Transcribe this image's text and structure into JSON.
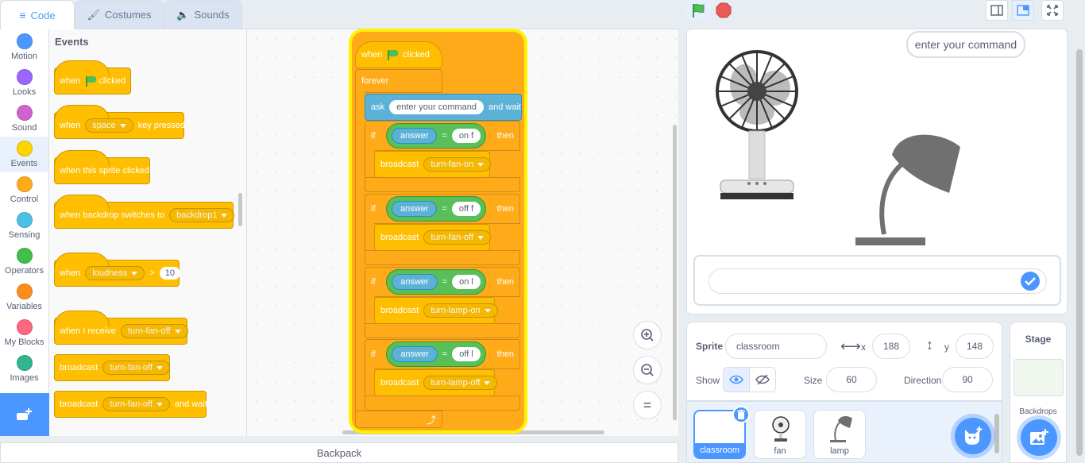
{
  "tabs": {
    "code": "Code",
    "costumes": "Costumes",
    "sounds": "Sounds"
  },
  "categories": [
    {
      "label": "Motion",
      "color": "#4c97ff"
    },
    {
      "label": "Looks",
      "color": "#9966ff"
    },
    {
      "label": "Sound",
      "color": "#cf63cf"
    },
    {
      "label": "Events",
      "color": "#ffd500"
    },
    {
      "label": "Control",
      "color": "#ffab19"
    },
    {
      "label": "Sensing",
      "color": "#4cbfe6"
    },
    {
      "label": "Operators",
      "color": "#40bf4a"
    },
    {
      "label": "Variables",
      "color": "#ff8c1a"
    },
    {
      "label": "My Blocks",
      "color": "#ff6680"
    },
    {
      "label": "Images",
      "color": "#2fb58f"
    }
  ],
  "palette": {
    "title": "Events",
    "when": "when",
    "clicked": "clicked",
    "key": "space",
    "key_pressed": "key pressed",
    "sprite_clicked": "when this sprite clicked",
    "backdrop_switches": "when backdrop switches to",
    "backdrop": "backdrop1",
    "loudness": "loudness",
    "gt": ">",
    "loudness_value": "10",
    "when_receive": "when I receive",
    "receive_msg": "turn-fan-off",
    "broadcast": "broadcast",
    "broadcast_msg": "turn-fan-off",
    "and_wait": "and wait"
  },
  "script": {
    "when": "when",
    "clicked": "clicked",
    "forever": "forever",
    "ask": "ask",
    "ask_text": "enter your command",
    "and_wait": "and wait",
    "if": "if",
    "then": "then",
    "answer": "answer",
    "eq": "=",
    "broadcast": "broadcast",
    "conditions": [
      {
        "value": "on f",
        "message": "turn-fan-on"
      },
      {
        "value": "off f",
        "message": "turn-fan-off"
      },
      {
        "value": "on l",
        "message": "turn-lamp-on"
      },
      {
        "value": "off l",
        "message": "turn-lamp-off"
      }
    ]
  },
  "zoom": {
    "plus": "+",
    "minus": "−",
    "reset": "="
  },
  "backpack": "Backpack",
  "stage": {
    "bubble": "enter your command",
    "ask_value": ""
  },
  "sprite_info": {
    "sprite_label": "Sprite",
    "sprite_name": "classroom",
    "x_label": "x",
    "x_value": "188",
    "y_label": "y",
    "y_value": "148",
    "show_label": "Show",
    "size_label": "Size",
    "size_value": "60",
    "direction_label": "Direction",
    "direction_value": "90"
  },
  "sprites": [
    {
      "name": "classroom"
    },
    {
      "name": "fan"
    },
    {
      "name": "lamp"
    }
  ],
  "stage_pane": {
    "title": "Stage",
    "backdrops": "Backdrops"
  },
  "colors": {
    "accent": "#4c97ff",
    "events": "#ffbf00",
    "control": "#ffab19",
    "sensing": "#5cb1d6",
    "operators": "#59c059",
    "highlight": "#fff200"
  }
}
